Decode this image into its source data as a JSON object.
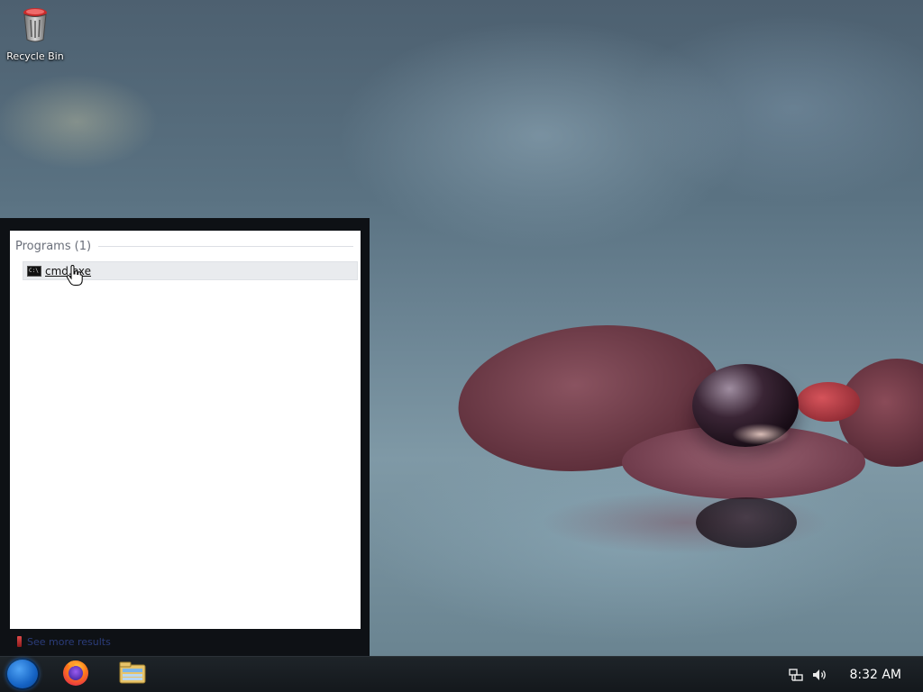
{
  "desktop": {
    "icons": [
      {
        "label": "Recycle Bin",
        "icon": "recycle-bin-icon"
      }
    ]
  },
  "start_menu": {
    "section": {
      "title": "Programs",
      "count": "(1)"
    },
    "results": [
      {
        "label": "cmd.exe",
        "icon": "command-prompt-icon"
      }
    ],
    "bottom_link": {
      "label": "See more results",
      "icon": "search-results-icon"
    }
  },
  "taskbar": {
    "start_button": {
      "icon": "start-orb-icon"
    },
    "pinned": [
      {
        "name": "Firefox",
        "icon": "firefox-icon"
      },
      {
        "name": "File Explorer",
        "icon": "file-explorer-icon"
      }
    ],
    "tray": {
      "icons": [
        "network-icon",
        "volume-icon"
      ],
      "clock": "8:32 AM"
    }
  },
  "colors": {
    "taskbar": "#171b1f",
    "start_orb": "#1563c4",
    "start_menu_frame": "#0e1115",
    "result_highlight": "#e9ebee"
  }
}
